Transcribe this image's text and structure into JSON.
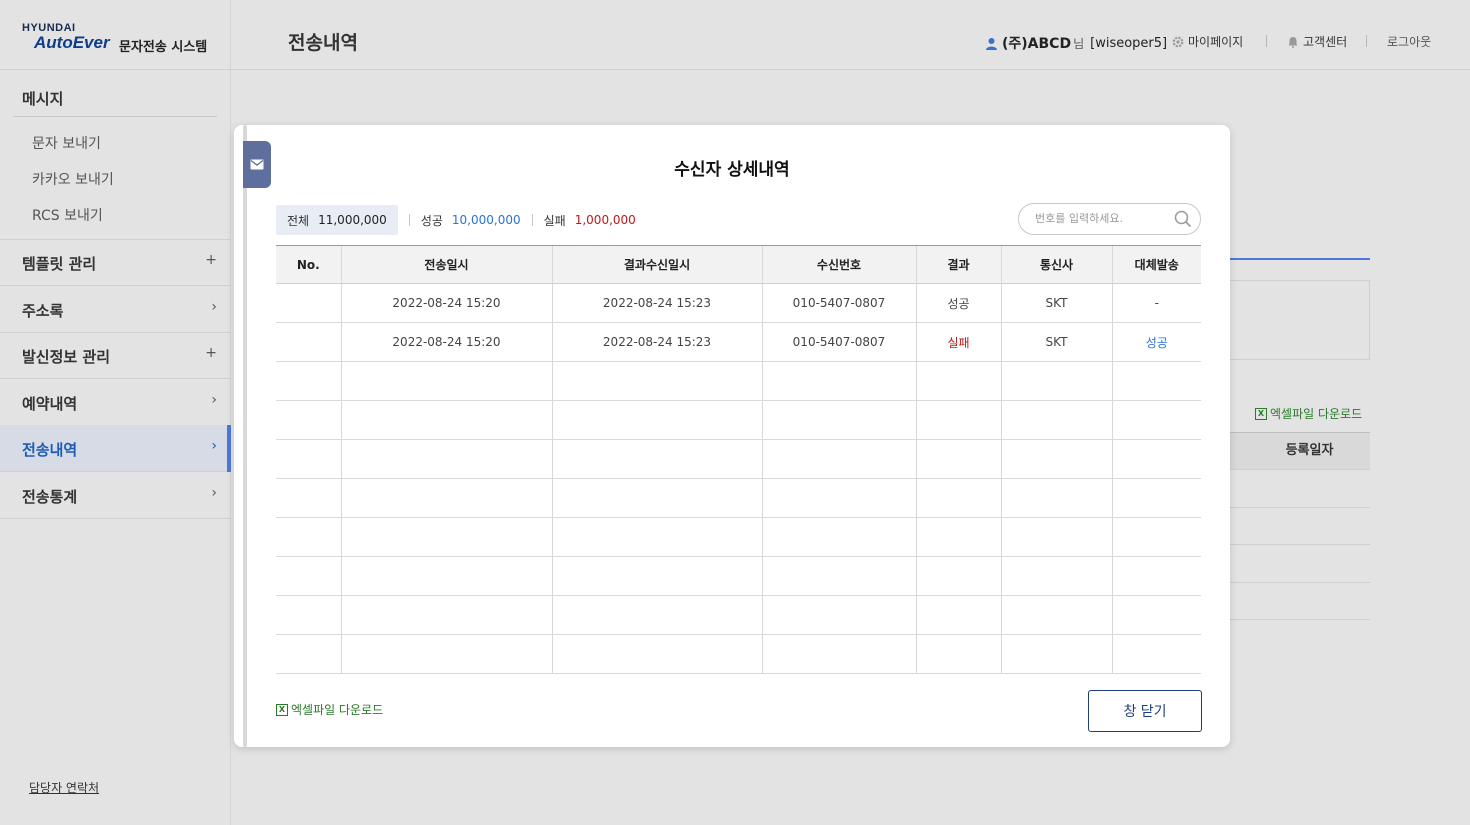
{
  "app": {
    "brand_top": "HYUNDAI",
    "brand_main": "AutoEver",
    "system_name": "문자전송 시스템",
    "page_title": "전송내역"
  },
  "header": {
    "company": "(주)ABCD",
    "honorific": "님",
    "user_id": "[wiseoper5]",
    "mypage": "마이페이지",
    "support": "고객센터",
    "logout": "로그아웃"
  },
  "sidebar": {
    "message_group": "메시지",
    "message_items": [
      "문자 보내기",
      "카카오 보내기",
      "RCS 보내기"
    ],
    "items": [
      {
        "label": "템플릿 관리",
        "mark": "+"
      },
      {
        "label": "주소록",
        "mark": "›"
      },
      {
        "label": "발신정보 관리",
        "mark": "+"
      },
      {
        "label": "예약내역",
        "mark": "›"
      },
      {
        "label": "전송내역",
        "mark": "›"
      },
      {
        "label": "전송통계",
        "mark": "›"
      }
    ],
    "contact": "담당자 연락처"
  },
  "background": {
    "excel_download": "엑셀파일 다운로드",
    "column_header": "등록일자"
  },
  "modal": {
    "title": "수신자 상세내역",
    "summary": {
      "total_label": "전체",
      "total_value": "11,000,000",
      "success_label": "성공",
      "success_value": "10,000,000",
      "fail_label": "실패",
      "fail_value": "1,000,000"
    },
    "search_placeholder": "번호를 입력하세요.",
    "columns": [
      "No.",
      "전송일시",
      "결과수신일시",
      "수신번호",
      "결과",
      "통신사",
      "대체발송"
    ],
    "rows": [
      [
        "",
        "2022-08-24 15:20",
        "2022-08-24 15:23",
        "010-5407-0807",
        "성공",
        "SKT",
        "-"
      ],
      [
        "",
        "2022-08-24 15:20",
        "2022-08-24 15:23",
        "010-5407-0807",
        "실패",
        "SKT",
        "성공"
      ],
      [
        "",
        "",
        "",
        "",
        "",
        "",
        ""
      ],
      [
        "",
        "",
        "",
        "",
        "",
        "",
        ""
      ],
      [
        "",
        "",
        "",
        "",
        "",
        "",
        ""
      ],
      [
        "",
        "",
        "",
        "",
        "",
        "",
        ""
      ],
      [
        "",
        "",
        "",
        "",
        "",
        "",
        ""
      ],
      [
        "",
        "",
        "",
        "",
        "",
        "",
        ""
      ],
      [
        "",
        "",
        "",
        "",
        "",
        "",
        ""
      ],
      [
        "",
        "",
        "",
        "",
        "",
        "",
        ""
      ]
    ],
    "excel_download": "엑셀파일 다운로드",
    "close_button": "창 닫기"
  },
  "colors": {
    "accent": "#4d78d8",
    "success": "#2a72d8",
    "fail": "#c01818",
    "excel": "#2b7a2b",
    "modal_tab": "#5e6f9e"
  }
}
